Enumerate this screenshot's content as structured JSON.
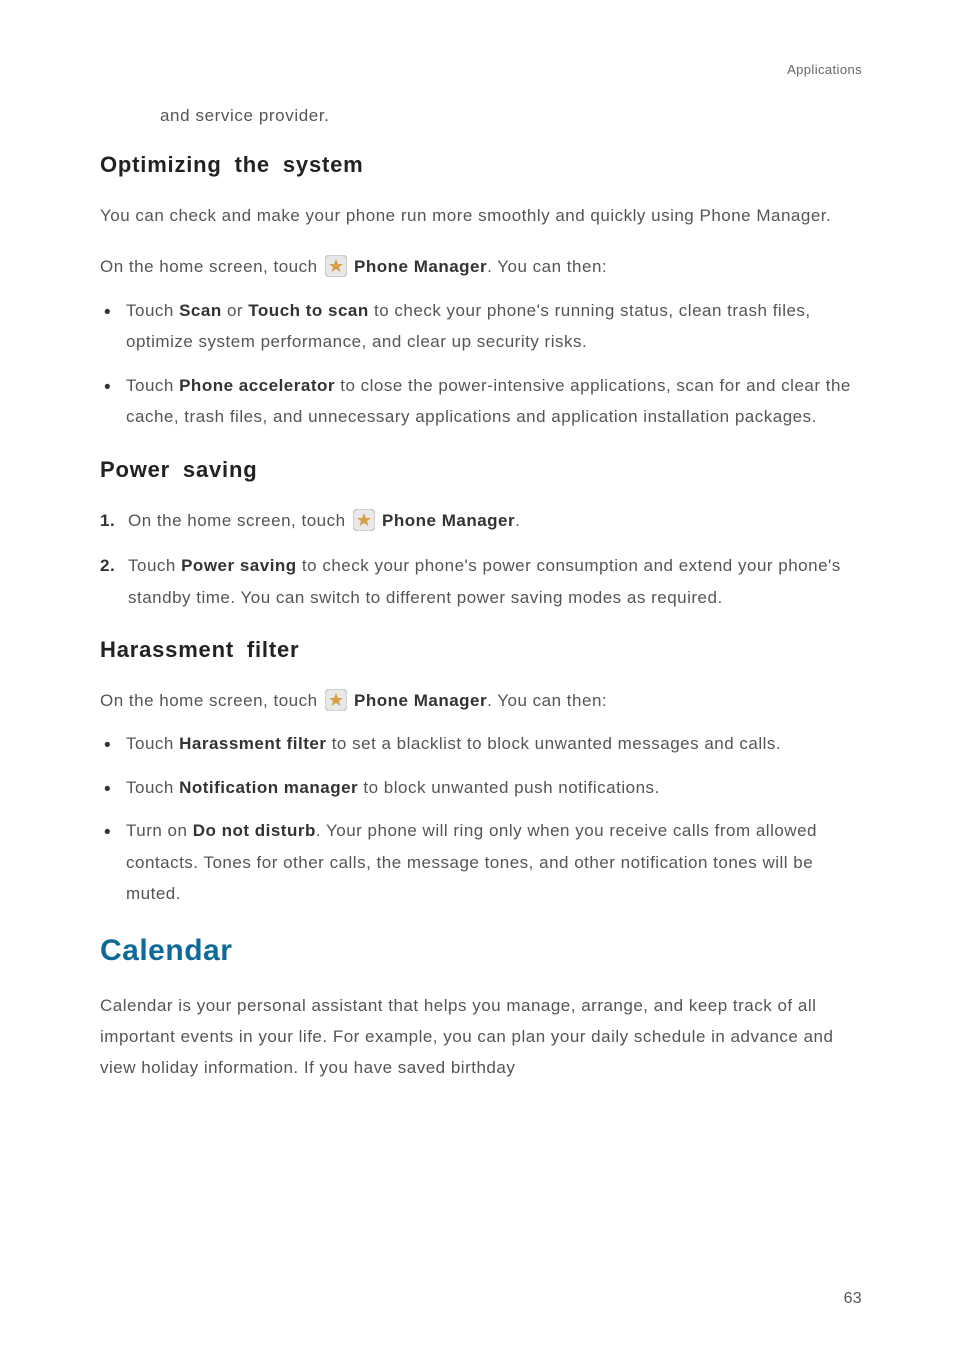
{
  "header": {
    "breadcrumb": "Applications"
  },
  "lead_continue": "and service provider.",
  "colors": {
    "major_heading": "#0f6999"
  },
  "sections": {
    "optimizing": {
      "title": "Optimizing the system",
      "intro": "You can check and make your phone run more smoothly and quickly using Phone Manager.",
      "line_pre": "On the home screen, touch ",
      "app_label": "Phone Manager",
      "line_post": ". You can then:",
      "bullets": [
        {
          "pre": "Touch ",
          "b1": "Scan",
          "mid": " or ",
          "b2": "Touch to scan",
          "post": " to check your phone's running status, clean trash files, optimize system performance, and clear up security risks."
        },
        {
          "pre": "Touch ",
          "b1": "Phone accelerator",
          "post": " to close the power-intensive applications, scan for and clear the cache, trash files, and unnecessary applications and application installation packages."
        }
      ]
    },
    "power": {
      "title": "Power saving",
      "steps": [
        {
          "pre": "On the home screen, touch ",
          "app_label": "Phone Manager",
          "post": "."
        },
        {
          "pre": "Touch ",
          "b1": "Power saving",
          "post": " to check your phone's power consumption and extend your phone's standby time. You can switch to different power saving modes as required."
        }
      ]
    },
    "harassment": {
      "title": "Harassment filter",
      "line_pre": "On the home screen, touch ",
      "app_label": "Phone Manager",
      "line_post": ". You can then:",
      "bullets": [
        {
          "pre": "Touch ",
          "b1": "Harassment filter",
          "post": " to set a blacklist to block unwanted messages and calls."
        },
        {
          "pre": "Touch ",
          "b1": "Notification manager",
          "post": " to block unwanted push notifications."
        },
        {
          "pre": "Turn on ",
          "b1": "Do not disturb",
          "post": ". Your phone will ring only when you receive calls from allowed contacts. Tones for other calls, the message tones, and other notification tones will be muted."
        }
      ]
    }
  },
  "major": {
    "title": "Calendar",
    "intro": "Calendar is your personal assistant that helps you manage, arrange, and keep track of all important events in your life. For example, you can plan your daily schedule in advance and view holiday information. If you have saved birthday"
  },
  "page_number": "63"
}
